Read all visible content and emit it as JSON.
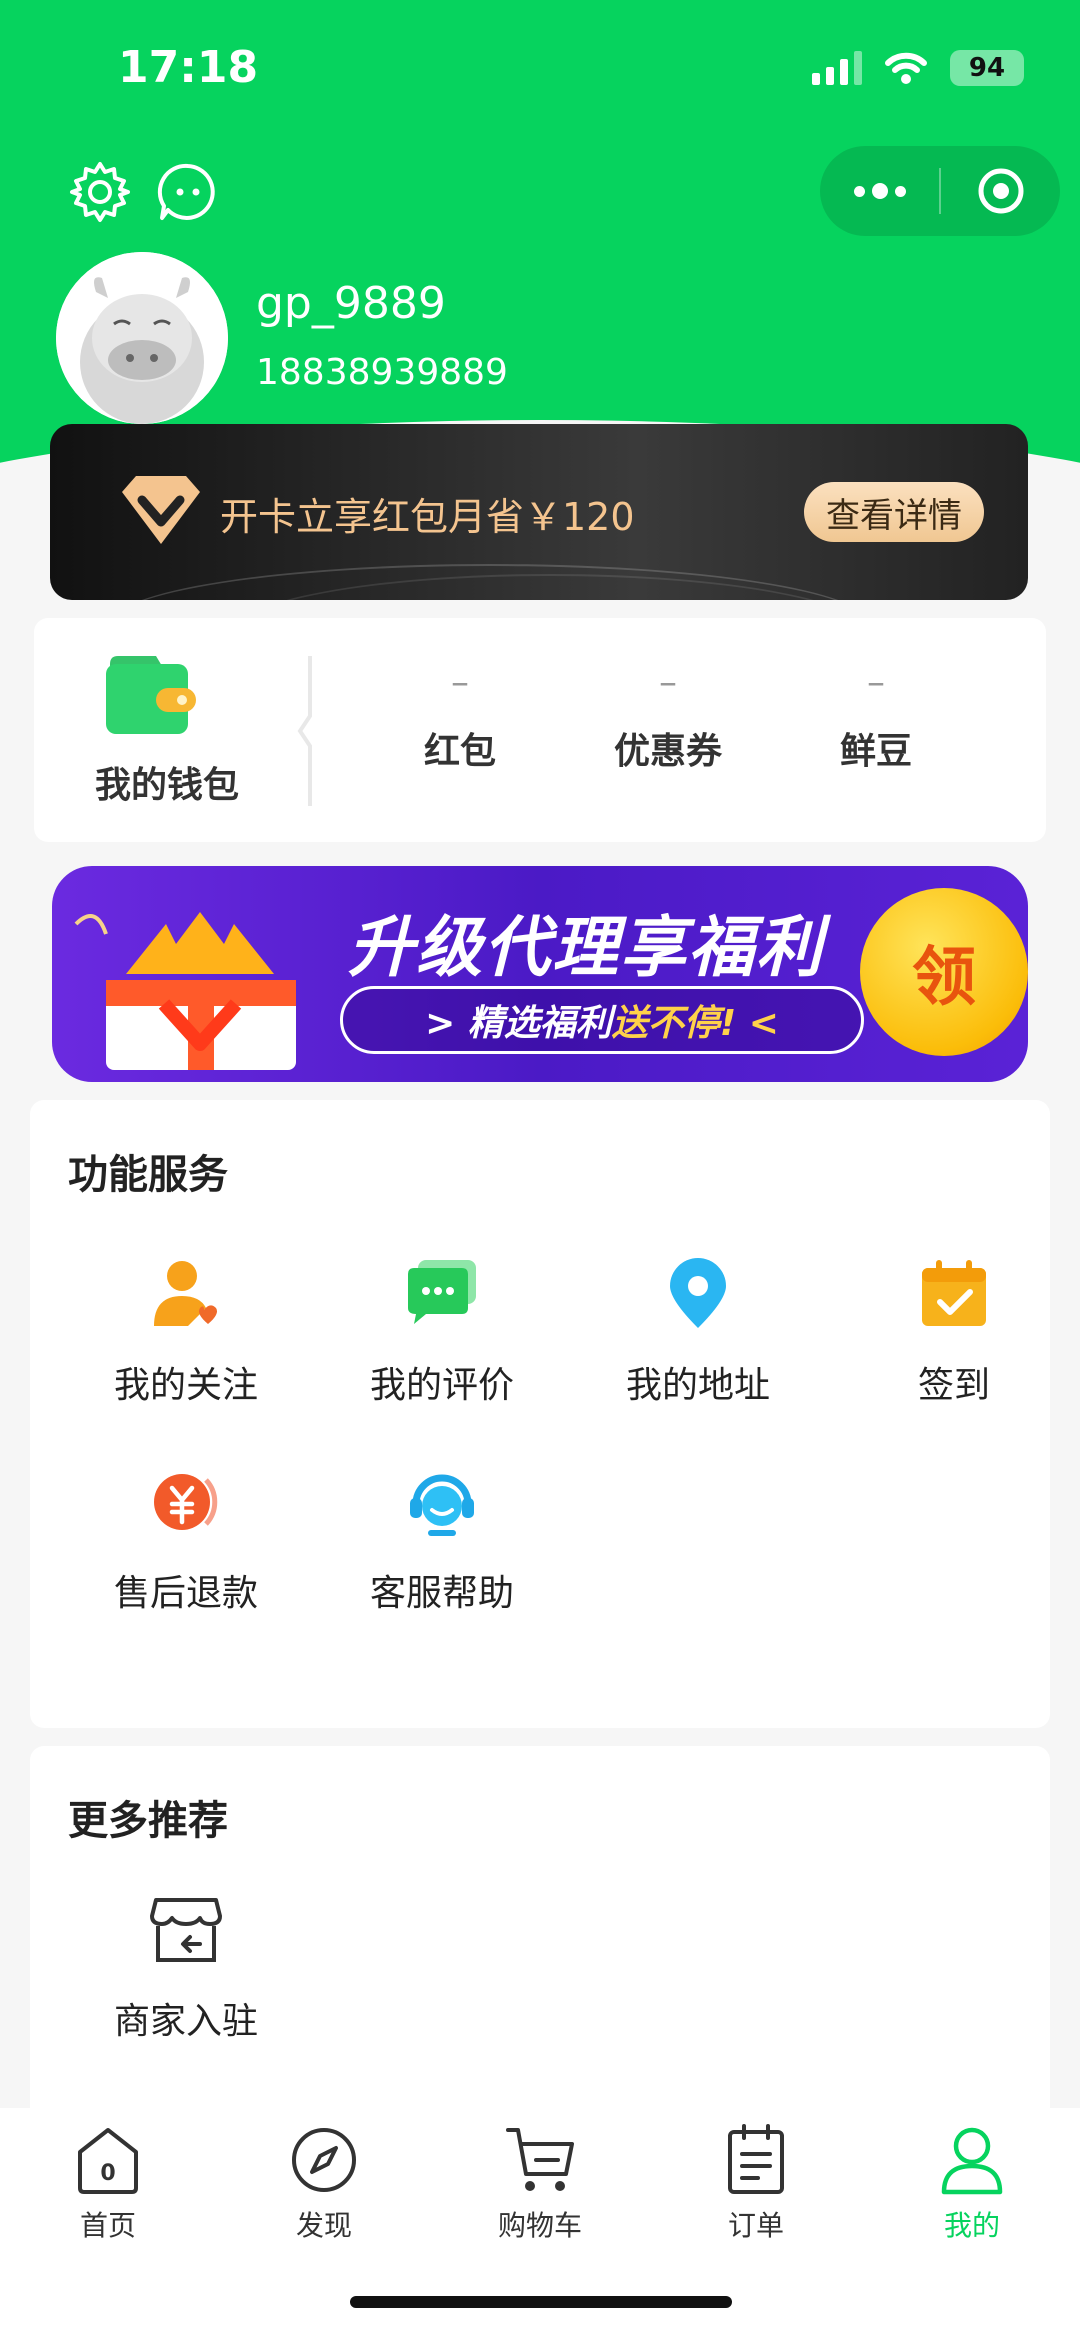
{
  "status_bar": {
    "time": "17:18",
    "battery": "94"
  },
  "profile": {
    "username": "gp_9889",
    "phone": "18838939889"
  },
  "vip_card": {
    "text": "开卡立享红包月省￥120",
    "button": "查看详情"
  },
  "wallet": {
    "label": "我的钱包",
    "stats": [
      {
        "value": "–",
        "label": "红包"
      },
      {
        "value": "–",
        "label": "优惠券"
      },
      {
        "value": "–",
        "label": "鲜豆"
      }
    ]
  },
  "promo": {
    "title": "升级代理享福利",
    "pill_a": "> 精选福利",
    "pill_b": "送不停! <",
    "coin": "领"
  },
  "services": {
    "title": "功能服务",
    "items": [
      {
        "label": "我的关注",
        "icon": "person-heart-icon"
      },
      {
        "label": "我的评价",
        "icon": "chat-bubbles-icon"
      },
      {
        "label": "我的地址",
        "icon": "location-pin-icon"
      },
      {
        "label": "签到",
        "icon": "calendar-check-icon"
      },
      {
        "label": "售后退款",
        "icon": "yuan-refund-icon"
      },
      {
        "label": "客服帮助",
        "icon": "headset-icon"
      }
    ]
  },
  "more": {
    "title": "更多推荐",
    "items": [
      {
        "label": "商家入驻",
        "icon": "storefront-icon"
      }
    ]
  },
  "tabbar": {
    "items": [
      {
        "label": "首页",
        "icon": "home-icon",
        "badge": "0"
      },
      {
        "label": "发现",
        "icon": "compass-icon"
      },
      {
        "label": "购物车",
        "icon": "cart-icon"
      },
      {
        "label": "订单",
        "icon": "order-icon"
      },
      {
        "label": "我的",
        "icon": "user-icon",
        "active": true
      }
    ]
  },
  "colors": {
    "brand": "#06d35e",
    "vip_gold": "#f4c48f",
    "promo_purple": "#5a22d6"
  }
}
